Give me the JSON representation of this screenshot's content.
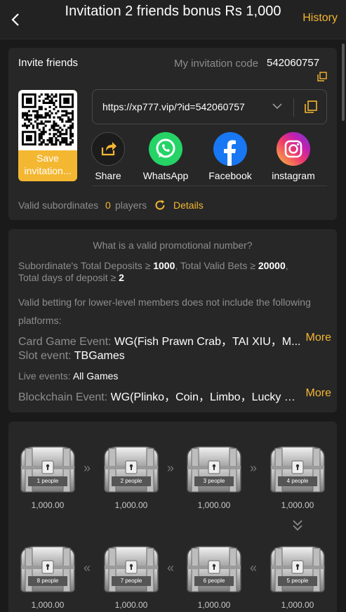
{
  "header": {
    "back_icon": "chevron-left-icon",
    "title": "Invitation 2 friends bonus Rs 1,000",
    "history": "History"
  },
  "invite": {
    "title": "Invite friends",
    "code_label": "My invitation code",
    "code_value": "542060757",
    "save_label": "Save invitation...",
    "link": "https://xp777.vip/?id=542060757",
    "share": [
      {
        "label": "Share",
        "icon": "share-icon"
      },
      {
        "label": "WhatsApp",
        "icon": "whatsapp-icon"
      },
      {
        "label": "Facebook",
        "icon": "facebook-icon"
      },
      {
        "label": "instagram",
        "icon": "instagram-icon"
      }
    ],
    "valid_label": "Valid subordinates",
    "valid_count": "0",
    "valid_unit": "players",
    "details": "Details"
  },
  "promo": {
    "title": "What is a valid promotional number?",
    "line1_prefix": "Subordinate's Total Deposits ≥ ",
    "line1_deposit": "1000",
    "line1_mid": ",  Total Valid Bets ≥ ",
    "line1_bets": "20000",
    "line1_end": ",",
    "line2_prefix": "Total days of deposit ≥ ",
    "line2_days": "2",
    "note1": "Valid betting for lower-level members does not include the following",
    "note2": "platforms:",
    "card_label": "Card Game Event: ",
    "card_value": "WG(Fish Prawn Crab，TAI XIU，M...",
    "slot_label": "Slot event: ",
    "slot_value": "TBGames",
    "live_label": "Live events: ",
    "live_value": "All Games",
    "block_label": "Blockchain Event: ",
    "block_value": "WG(Plinko，Coin，Limbo，Lucky Di...",
    "more": "More"
  },
  "rewards": {
    "row1": [
      {
        "label": "1 people",
        "amount": "1,000.00"
      },
      {
        "label": "2 people",
        "amount": "1,000.00"
      },
      {
        "label": "3 people",
        "amount": "1,000.00"
      },
      {
        "label": "4 people",
        "amount": "1,000.00"
      }
    ],
    "row2": [
      {
        "label": "8 people",
        "amount": "1,000.00"
      },
      {
        "label": "7 people",
        "amount": "1,000.00"
      },
      {
        "label": "6 people",
        "amount": "1,000.00"
      },
      {
        "label": "5 people",
        "amount": "1,000.00"
      }
    ]
  },
  "colors": {
    "accent": "#f4b731",
    "background": "#1a1a1a",
    "card": "#272727",
    "whatsapp": "#25d366",
    "facebook": "#1877f2"
  }
}
